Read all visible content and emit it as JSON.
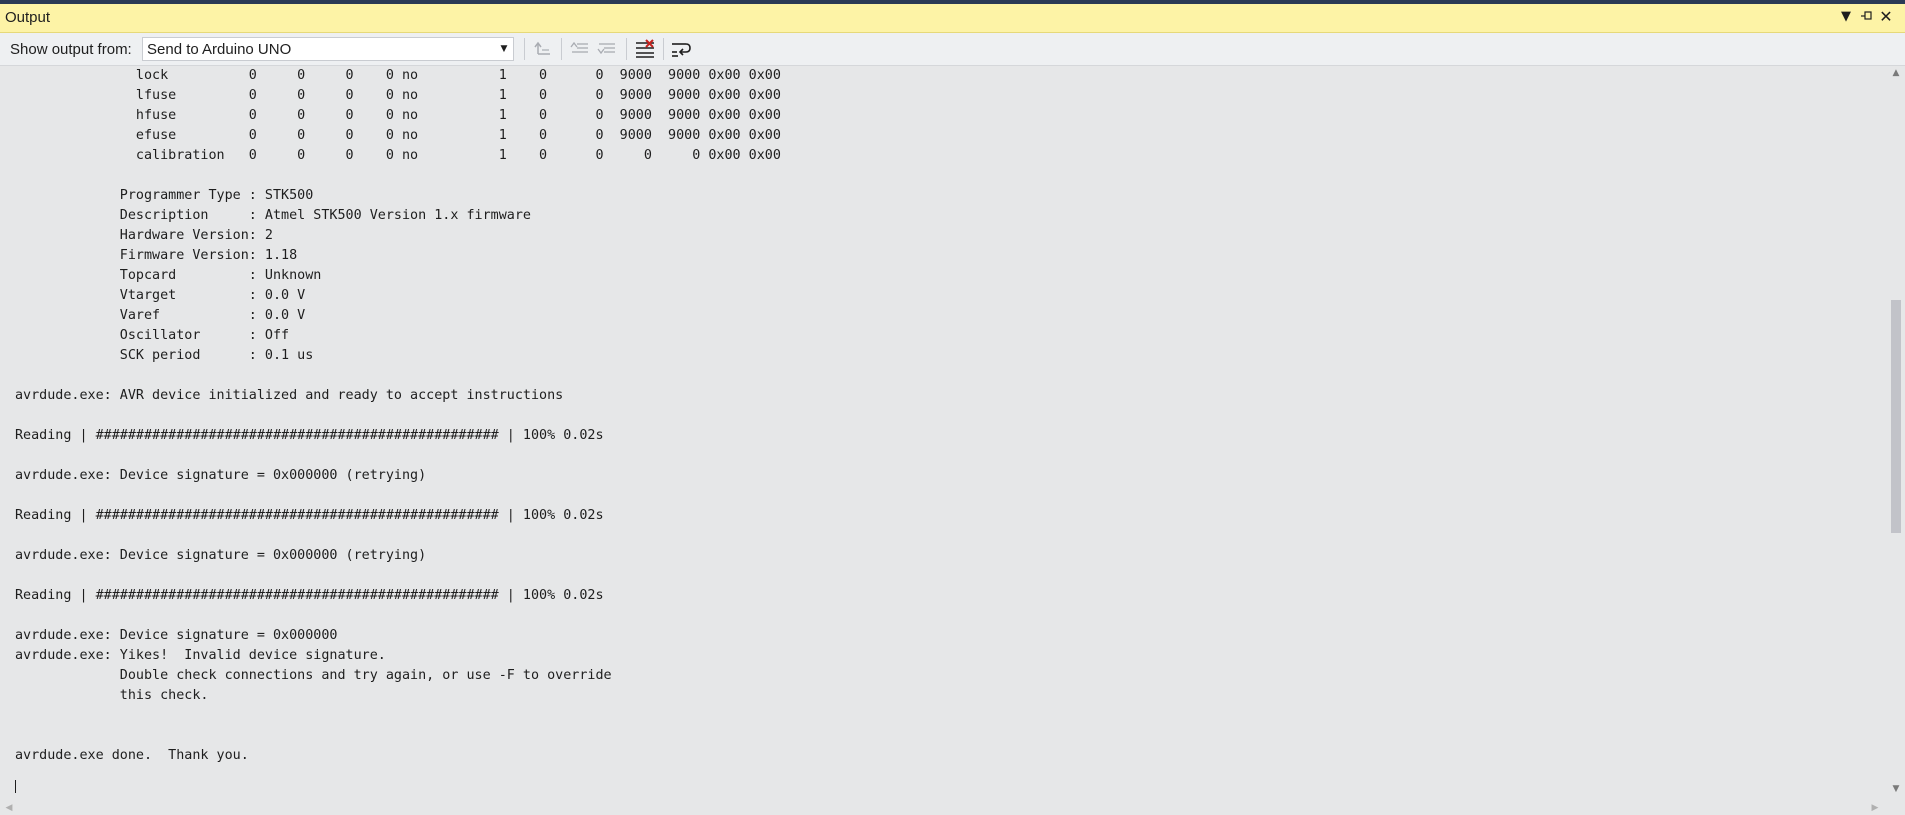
{
  "window": {
    "title": "Output",
    "dropdown_icon": "chevron-down-icon",
    "pin_icon": "pin-icon",
    "close_icon": "close-icon"
  },
  "toolbar": {
    "show_output_label": "Show output from:",
    "source_selected": "Send to Arduino UNO",
    "icons": [
      "find-message-in-code-icon",
      "go-to-previous-message-icon",
      "go-to-next-message-icon",
      "clear-all-icon",
      "toggle-word-wrap-icon"
    ]
  },
  "output": {
    "lines": [
      "               lock          0     0     0    0 no          1    0      0  9000  9000 0x00 0x00",
      "               lfuse         0     0     0    0 no          1    0      0  9000  9000 0x00 0x00",
      "               hfuse         0     0     0    0 no          1    0      0  9000  9000 0x00 0x00",
      "               efuse         0     0     0    0 no          1    0      0  9000  9000 0x00 0x00",
      "               calibration   0     0     0    0 no          1    0      0     0     0 0x00 0x00",
      "",
      "             Programmer Type : STK500",
      "             Description     : Atmel STK500 Version 1.x firmware",
      "             Hardware Version: 2",
      "             Firmware Version: 1.18",
      "             Topcard         : Unknown",
      "             Vtarget         : 0.0 V",
      "             Varef           : 0.0 V",
      "             Oscillator      : Off",
      "             SCK period      : 0.1 us",
      "",
      "avrdude.exe: AVR device initialized and ready to accept instructions",
      "",
      "Reading | ################################################## | 100% 0.02s",
      "",
      "avrdude.exe: Device signature = 0x000000 (retrying)",
      "",
      "Reading | ################################################## | 100% 0.02s",
      "",
      "avrdude.exe: Device signature = 0x000000 (retrying)",
      "",
      "Reading | ################################################## | 100% 0.02s",
      "",
      "avrdude.exe: Device signature = 0x000000",
      "avrdude.exe: Yikes!  Invalid device signature.",
      "             Double check connections and try again, or use -F to override",
      "             this check.",
      "",
      "",
      "avrdude.exe done.  Thank you.",
      ""
    ]
  }
}
